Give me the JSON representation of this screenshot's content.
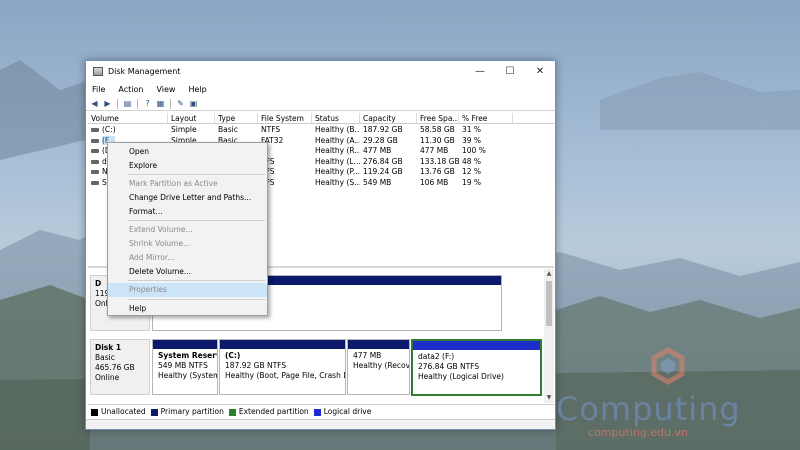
{
  "window": {
    "title": "Disk Management",
    "minimize": "—",
    "maximize": "☐",
    "close": "✕"
  },
  "menu": [
    "File",
    "Action",
    "View",
    "Help"
  ],
  "volume_list": {
    "columns": [
      "Volume",
      "Layout",
      "Type",
      "File System",
      "Status",
      "Capacity",
      "Free Spa...",
      "% Free"
    ],
    "rows": [
      {
        "volume": "(C:)",
        "layout": "Simple",
        "type": "Basic",
        "fs": "NTFS",
        "status": "Healthy (B...",
        "capacity": "187.92 GB",
        "free": "58.58 GB",
        "pct": "31 %"
      },
      {
        "volume": "(F...",
        "layout": "Simple",
        "type": "Basic",
        "fs": "FAT32",
        "status": "Healthy (A...",
        "capacity": "29.28 GB",
        "free": "11.30 GB",
        "pct": "39 %"
      },
      {
        "volume": "(D",
        "layout": "",
        "type": "",
        "fs": "",
        "status": "Healthy (R...",
        "capacity": "477 MB",
        "free": "477 MB",
        "pct": "100 %"
      },
      {
        "volume": "da",
        "layout": "",
        "type": "",
        "fs": "TFS",
        "status": "Healthy (L...",
        "capacity": "276.84 GB",
        "free": "133.18 GB",
        "pct": "48 %"
      },
      {
        "volume": "Ne",
        "layout": "",
        "type": "",
        "fs": "TFS",
        "status": "Healthy (P...",
        "capacity": "119.24 GB",
        "free": "13.76 GB",
        "pct": "12 %"
      },
      {
        "volume": "Sy",
        "layout": "",
        "type": "",
        "fs": "TFS",
        "status": "Healthy (S...",
        "capacity": "549 MB",
        "free": "106 MB",
        "pct": "19 %"
      }
    ]
  },
  "disk0": {
    "name": "D",
    "size": "119.2",
    "status": "Onlin"
  },
  "disk1": {
    "name": "Disk 1",
    "type": "Basic",
    "size": "465.76 GB",
    "status": "Online",
    "partitions": [
      {
        "name": "System Reserve",
        "size": "549 MB NTFS",
        "status": "Healthy (System,"
      },
      {
        "name": "(C:)",
        "size": "187.92 GB NTFS",
        "status": "Healthy (Boot, Page File, Crash Dum"
      },
      {
        "name": "",
        "size": "477 MB",
        "status": "Healthy (Recove"
      },
      {
        "name": "data2  (F:)",
        "size": "276.84 GB NTFS",
        "status": "Healthy (Logical Drive)"
      }
    ]
  },
  "legend": [
    {
      "label": "Unallocated",
      "color": "#000000"
    },
    {
      "label": "Primary partition",
      "color": "#0b1a6b"
    },
    {
      "label": "Extended partition",
      "color": "#2e7d32"
    },
    {
      "label": "Logical drive",
      "color": "#1c2dcc"
    }
  ],
  "context_menu": [
    {
      "label": "Open",
      "state": "enabled"
    },
    {
      "label": "Explore",
      "state": "enabled"
    },
    {
      "sep": true
    },
    {
      "label": "Mark Partition as Active",
      "state": "disabled"
    },
    {
      "label": "Change Drive Letter and Paths...",
      "state": "enabled"
    },
    {
      "label": "Format...",
      "state": "enabled"
    },
    {
      "sep": true
    },
    {
      "label": "Extend Volume...",
      "state": "disabled"
    },
    {
      "label": "Shrink Volume...",
      "state": "disabled"
    },
    {
      "label": "Add Mirror...",
      "state": "disabled"
    },
    {
      "label": "Delete Volume...",
      "state": "enabled"
    },
    {
      "sep": true
    },
    {
      "label": "Properties",
      "state": "hover"
    },
    {
      "sep": true
    },
    {
      "label": "Help",
      "state": "enabled"
    }
  ],
  "watermark": {
    "brand": "Computing",
    "url": "computing.edu.vn"
  }
}
